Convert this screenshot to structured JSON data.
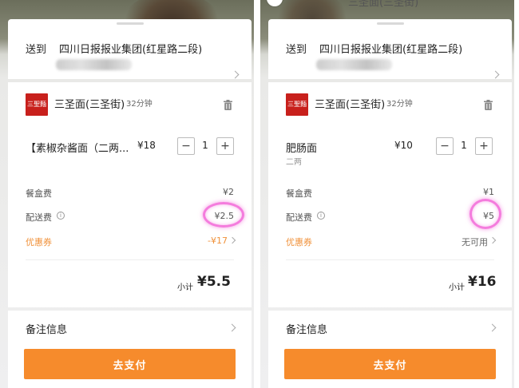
{
  "panels": [
    {
      "top_title": "",
      "address_label": "送到",
      "address_value": "四川日报报业集团(红星路二段)",
      "shop_logo_text": "三聖麵",
      "shop_name": "三圣面(三圣街)",
      "shop_time": "32分钟",
      "item_name": "【素椒杂酱面（二两...",
      "item_sub": "",
      "item_price": "¥18",
      "quantity": "1",
      "minus": "−",
      "plus": "+",
      "box_fee_label": "餐盒费",
      "box_fee_value": "¥2",
      "delivery_fee_label": "配送费",
      "delivery_fee_value": "¥2.5",
      "coupon_label": "优惠券",
      "coupon_value": "-¥17",
      "subtotal_label": "小计",
      "subtotal_value": "¥5.5",
      "note_label": "备注信息",
      "pay_label": "去支付"
    },
    {
      "top_title": "三圣面(三圣街)",
      "address_label": "送到",
      "address_value": "四川日报报业集团(红星路二段)",
      "shop_logo_text": "三聖麵",
      "shop_name": "三圣面(三圣街)",
      "shop_time": "32分钟",
      "item_name": "肥肠面",
      "item_sub": "二两",
      "item_price": "¥10",
      "quantity": "1",
      "minus": "−",
      "plus": "+",
      "box_fee_label": "餐盒费",
      "box_fee_value": "¥1",
      "delivery_fee_label": "配送费",
      "delivery_fee_value": "¥5",
      "coupon_label": "优惠券",
      "coupon_value": "无可用",
      "subtotal_label": "小计",
      "subtotal_value": "¥16",
      "note_label": "备注信息",
      "pay_label": "去支付"
    }
  ],
  "icons": {
    "info": "i",
    "trash": "trash-icon",
    "chevron": "chevron-right-icon"
  },
  "colors": {
    "accent_orange": "#f68b2c",
    "coupon_orange": "#f0913a",
    "logo_red": "#c8201c",
    "highlight_pink": "#f050d2"
  }
}
